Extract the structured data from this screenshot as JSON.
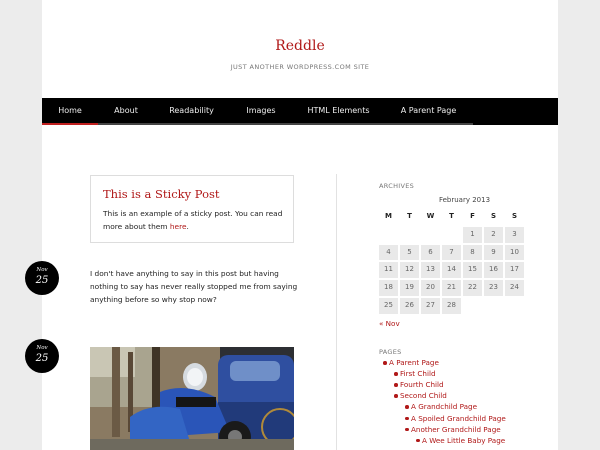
{
  "site": {
    "title": "Reddle",
    "tagline": "JUST ANOTHER WORDPRESS.COM SITE"
  },
  "nav": {
    "items": [
      {
        "label": "Home",
        "active": true
      },
      {
        "label": "About",
        "active": false
      },
      {
        "label": "Readability",
        "active": false
      },
      {
        "label": "Images",
        "active": false
      },
      {
        "label": "HTML Elements",
        "active": false
      },
      {
        "label": "A Parent Page",
        "active": false
      }
    ]
  },
  "posts": {
    "sticky": {
      "title": "This is a Sticky Post",
      "text": "This is an example of a sticky post. You can read more about them ",
      "link": "here",
      "after": "."
    },
    "post2": {
      "month": "Nov",
      "day": "25",
      "text": "I don't have anything to say in this post but having nothing to say has never really stopped me from saying anything before so why stop now?"
    },
    "post3": {
      "month": "Nov",
      "day": "25"
    }
  },
  "sidebar": {
    "archives_title": "ARCHIVES",
    "calendar": {
      "caption": "February 2013",
      "weekdays": [
        "M",
        "T",
        "W",
        "T",
        "F",
        "S",
        "S"
      ],
      "leading_blanks": 4,
      "days": [
        "1",
        "2",
        "3",
        "4",
        "5",
        "6",
        "7",
        "8",
        "9",
        "10",
        "11",
        "12",
        "13",
        "14",
        "15",
        "16",
        "17",
        "18",
        "19",
        "20",
        "21",
        "22",
        "23",
        "24",
        "25",
        "26",
        "27",
        "28"
      ],
      "prev_link": "« Nov"
    },
    "pages_title": "PAGES",
    "pages": [
      {
        "label": "A Parent Page",
        "depth": 0
      },
      {
        "label": "First Child",
        "depth": 1
      },
      {
        "label": "Fourth Child",
        "depth": 1
      },
      {
        "label": "Second Child",
        "depth": 1
      },
      {
        "label": "A Grandchild Page",
        "depth": 2
      },
      {
        "label": "A Spoiled Grandchild Page",
        "depth": 2
      },
      {
        "label": "Another Grandchild Page",
        "depth": 2
      },
      {
        "label": "A Wee Little Baby Page",
        "depth": 3
      }
    ]
  },
  "colors": {
    "accent": "#b01818",
    "nav_bg": "#000000",
    "page_bg": "#ffffff",
    "body_bg": "#ececec"
  }
}
